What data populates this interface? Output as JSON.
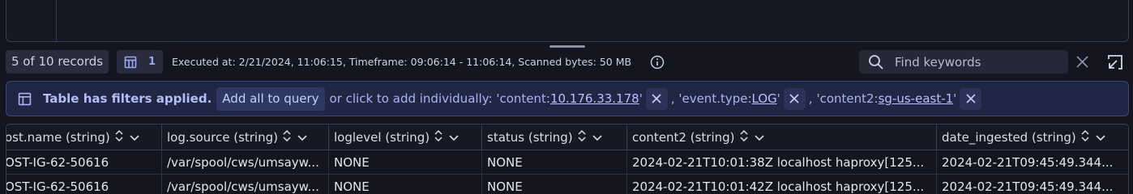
{
  "status": {
    "records_label": "5 of 10 records",
    "table_count": "1",
    "executed_text": "Executed at: 2/21/2024, 11:06:15, Timeframe: 09:06:14 - 11:06:14, Scanned bytes: 50 MB",
    "search_placeholder": "Find keywords"
  },
  "filter": {
    "title": "Table has filters applied.",
    "add_all_label": "Add all to query",
    "instructions": "or click to add individually: 'content: ",
    "filters": [
      {
        "link": "10.176.33.178",
        "prefix": "'content: ",
        "suffix": " '"
      },
      {
        "link": "LOG",
        "prefix": ", 'event.type: ",
        "suffix": " '"
      },
      {
        "link": "sg-us-east-1",
        "prefix": ", 'content2: ",
        "suffix": " '"
      }
    ],
    "f2_prefix": ", 'event.type: ",
    "f3_prefix": ", 'content2: ",
    "quote_suffix": " '"
  },
  "table": {
    "columns": [
      "ost.name (string)",
      "log.source (string)",
      "loglevel (string)",
      "status (string)",
      "content2 (string)",
      "date_ingested (string)"
    ],
    "rows": [
      [
        "OST-IG-62-50616",
        "/var/spool/cws/umsayw...",
        "NONE",
        "NONE",
        "2024-02-21T10:01:38Z localhost haproxy[125...",
        "2024-02-21T09:45:49.344..."
      ],
      [
        "OST-IG-62-50616",
        "/var/spool/cws/umsayw...",
        "NONE",
        "NONE",
        "2024-02-21T10:01:42Z localhost haproxy[125...",
        "2024-02-21T09:45:49.344..."
      ]
    ]
  },
  "colors": {
    "background": "#14151f",
    "accent": "#9aa6f5",
    "banner": "#202744"
  },
  "icons": {
    "table": "table-icon",
    "info": "info-icon",
    "search": "search-icon",
    "clear": "close-icon",
    "expand": "expand-icon",
    "sort": "sort-icon",
    "chevron": "chevron-down-icon"
  }
}
